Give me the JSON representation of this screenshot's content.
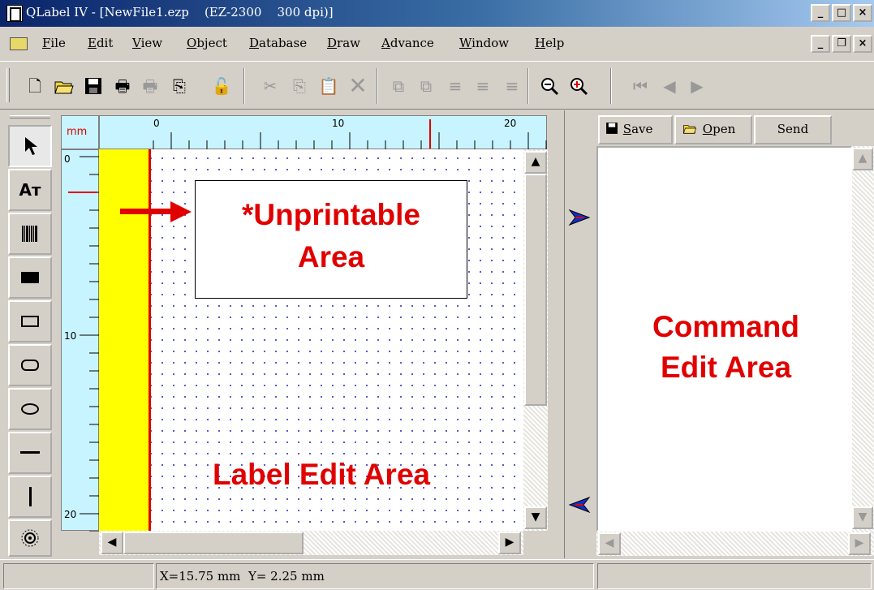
{
  "window": {
    "title": "QLabel IV - [NewFile1.ezp    (EZ-2300    300 dpi)]",
    "buttons": {
      "minimize": "_",
      "maximize": "□",
      "close": "×"
    }
  },
  "menu": {
    "items": [
      {
        "u": "F",
        "rest": "ile"
      },
      {
        "u": "E",
        "rest": "dit"
      },
      {
        "u": "V",
        "rest": "iew"
      },
      {
        "u": "O",
        "rest": "bject"
      },
      {
        "u": "D",
        "rest": "atabase"
      },
      {
        "u": "D",
        "rest": "raw"
      },
      {
        "u": "A",
        "rest": "dvance"
      },
      {
        "u": "W",
        "rest": "indow"
      },
      {
        "u": "H",
        "rest": "elp"
      }
    ],
    "mdi_buttons": {
      "minimize": "_",
      "restore": "❐",
      "close": "×"
    }
  },
  "toolbar": {
    "icons": [
      "new-file-icon",
      "open-folder-icon",
      "save-icon",
      "print-icon",
      "print-preview-icon",
      "copy-pages-icon",
      "lock-icon",
      "cut-icon",
      "copy-icon",
      "paste-icon",
      "delete-icon",
      "bring-front-icon",
      "send-back-icon",
      "align-left-icon",
      "align-center-icon",
      "align-right-icon",
      "zoom-out-icon",
      "zoom-in-icon",
      "first-page-icon",
      "prev-page-icon",
      "next-page-icon"
    ]
  },
  "toolbox": {
    "tools": [
      "pointer-tool",
      "text-tool",
      "barcode-tool",
      "filled-rect-tool",
      "rect-tool",
      "rounded-rect-tool",
      "ellipse-tool",
      "horizontal-line-tool",
      "vertical-line-tool",
      "sensor-tool"
    ],
    "text_tool_glyph": "Aᴛ"
  },
  "ruler": {
    "unit": "mm",
    "h_labels": [
      "0",
      "10",
      "20"
    ],
    "v_labels": [
      "0",
      "10",
      "20"
    ]
  },
  "label_area": {
    "callout_line1": "*Unprintable",
    "callout_line2": "Area",
    "caption": "Label Edit Area"
  },
  "command_panel": {
    "save_u": "S",
    "save_rest": "ave",
    "open_u": "O",
    "open_rest": "pen",
    "send_label": "Send",
    "caption_line1": "Command",
    "caption_line2": "Edit Area"
  },
  "status": {
    "coords": "X=15.75 mm  Y= 2.25 mm"
  },
  "colors": {
    "accent_red": "#e00000",
    "unprintable_yellow": "#ffff00",
    "ruler_bg": "#c8f4ff"
  }
}
